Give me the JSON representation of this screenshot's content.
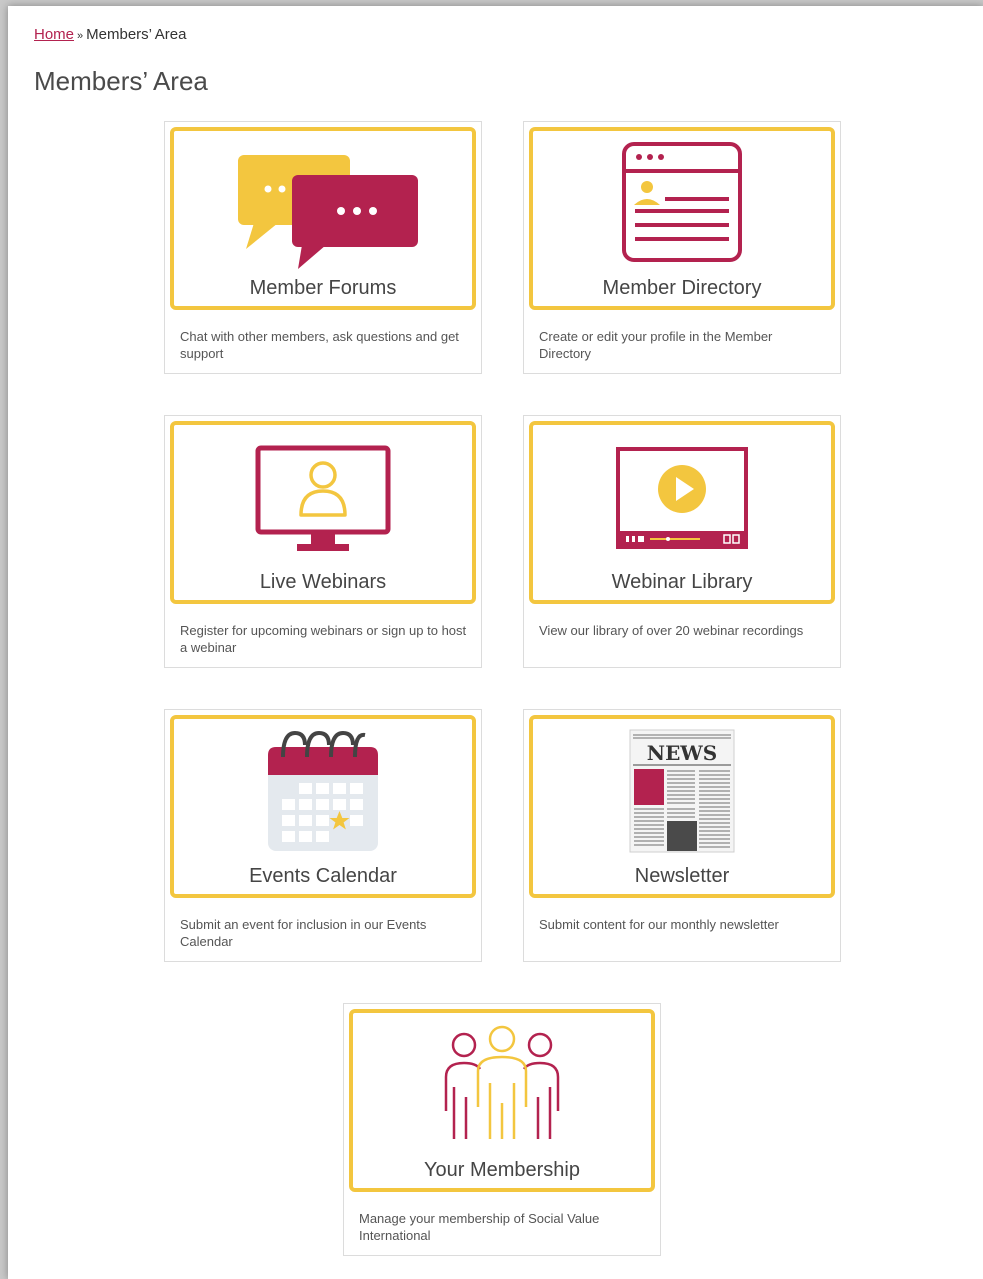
{
  "breadcrumb": {
    "home": "Home",
    "separator": "»",
    "current": "Members’ Area"
  },
  "page": {
    "title": "Members’ Area"
  },
  "colors": {
    "accent_yellow": "#f3c63f",
    "accent_crimson": "#b3224f",
    "link": "#b3224f"
  },
  "cards": [
    {
      "title": "Member Forums",
      "description": "Chat with other members, ask questions and get support",
      "icon": "chat-bubbles-icon"
    },
    {
      "title": "Member Directory",
      "description": "Create or edit your profile in the Member Directory",
      "icon": "profile-window-icon"
    },
    {
      "title": "Live Webinars",
      "description": "Register for upcoming webinars or sign up to host a webinar",
      "icon": "monitor-user-icon"
    },
    {
      "title": "Webinar Library",
      "description": "View our library of over 20 webinar recordings",
      "icon": "video-player-icon"
    },
    {
      "title": "Events Calendar",
      "description": "Submit an event for inclusion in our Events Calendar",
      "icon": "calendar-icon"
    },
    {
      "title": "Newsletter",
      "description": "Submit content for our monthly newsletter",
      "icon": "newspaper-icon",
      "icon_text": "NEWS"
    },
    {
      "title": "Your Membership",
      "description": "Manage your membership of Social Value International",
      "icon": "people-group-icon"
    }
  ]
}
